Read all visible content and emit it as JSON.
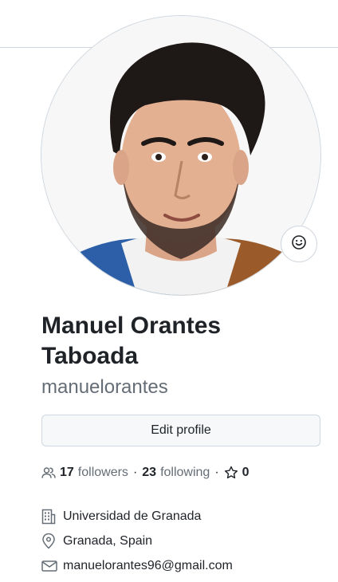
{
  "profile": {
    "full_name": "Manuel Orantes Taboada",
    "username": "manuelorantes",
    "avatar_alt": "Profile photo of a young man with dark curly hair and a short beard",
    "status_icon": "smiley-icon",
    "edit_button_label": "Edit profile"
  },
  "stats": {
    "followers_count": "17",
    "followers_label": "followers",
    "following_count": "23",
    "following_label": "following",
    "stars_count": "0",
    "separator": "·"
  },
  "details": {
    "organization": "Universidad de Granada",
    "location": "Granada, Spain",
    "email": "manuelorantes96@gmail.com"
  },
  "icons": {
    "people": "people-icon",
    "star": "star-icon",
    "organization": "building-icon",
    "location": "location-pin-icon",
    "email": "mail-icon"
  },
  "colors": {
    "text_primary": "#1f2328",
    "text_muted": "#656d76",
    "border": "#d0d7de",
    "button_bg": "#f6f8fa"
  }
}
